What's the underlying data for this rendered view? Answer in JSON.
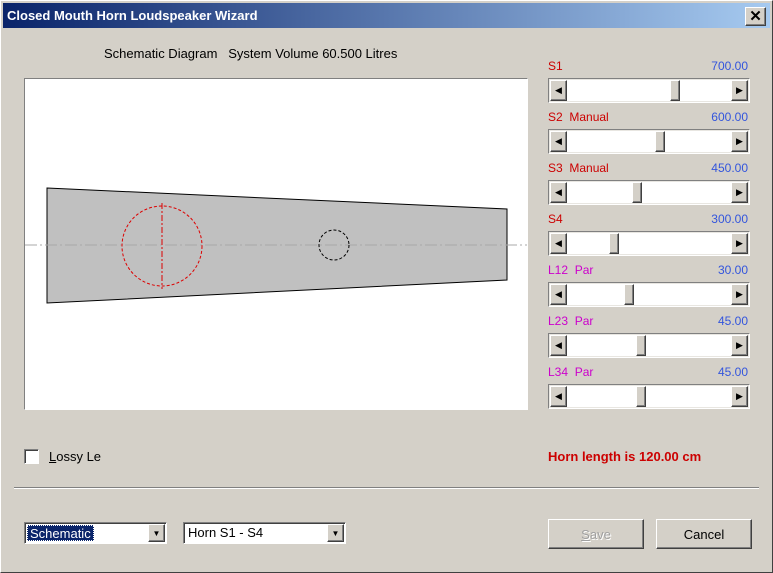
{
  "window": {
    "title": "Closed Mouth Horn Loudspeaker Wizard",
    "close_glyph": "✕"
  },
  "diagram": {
    "title": "Schematic Diagram   System Volume 60.500 Litres"
  },
  "params": [
    {
      "label": "S1",
      "value": "700.00",
      "label_color": "#cc0000",
      "position": 0.67
    },
    {
      "label": "S2  Manual",
      "value": "600.00",
      "label_color": "#cc0000",
      "position": 0.57
    },
    {
      "label": "S3  Manual",
      "value": "450.00",
      "label_color": "#cc0000",
      "position": 0.42
    },
    {
      "label": "S4",
      "value": "300.00",
      "label_color": "#cc0000",
      "position": 0.27
    },
    {
      "label": "L12  Par",
      "value": "30.00",
      "label_color": "#cc00cc",
      "position": 0.37
    },
    {
      "label": "L23  Par",
      "value": "45.00",
      "label_color": "#cc00cc",
      "position": 0.45
    },
    {
      "label": "L34  Par",
      "value": "45.00",
      "label_color": "#cc00cc",
      "position": 0.45
    }
  ],
  "value_color": "#3355dd",
  "lossy": {
    "label_first": "L",
    "label_rest": "ossy Le",
    "checked": false
  },
  "horn_length": "Horn length is 120.00 cm",
  "view_combo": {
    "selected": "Schematic"
  },
  "horn_combo": {
    "selected": "Horn S1 - S4"
  },
  "save_button": {
    "label_first": "S",
    "label_rest": "ave",
    "enabled": false
  },
  "cancel_button": {
    "label": "Cancel"
  },
  "icons": {
    "close": "close-icon",
    "left": "arrow-left-icon",
    "right": "arrow-right-icon",
    "dropdown": "dropdown-arrow-icon"
  }
}
